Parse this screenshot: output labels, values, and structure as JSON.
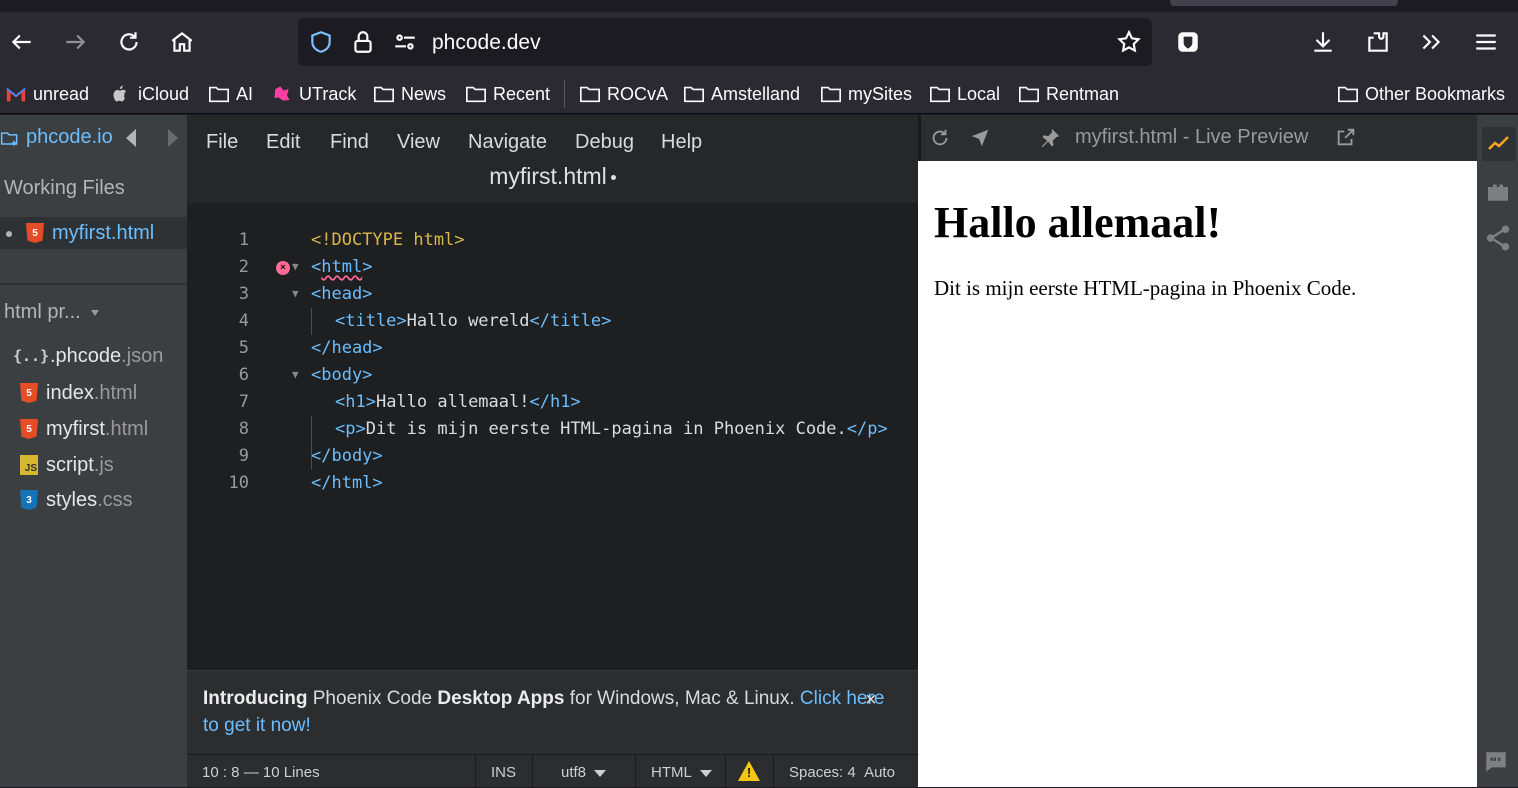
{
  "browser": {
    "url": "phcode.dev",
    "icons": [
      "back-icon",
      "forward-icon",
      "reload-icon",
      "home-icon",
      "shield-icon",
      "lock-icon",
      "permissions-icon",
      "bookmark-star-icon",
      "bitwarden-icon",
      "download-icon",
      "extensions-icon",
      "overflow-icon",
      "menu-icon"
    ],
    "bookmarks": [
      {
        "label": "unread",
        "icon": "gmail-icon"
      },
      {
        "label": "iCloud",
        "icon": "apple-icon"
      },
      {
        "label": "AI",
        "icon": "folder-icon"
      },
      {
        "label": "UTrack",
        "icon": "utrack-icon"
      },
      {
        "label": "News",
        "icon": "folder-icon"
      },
      {
        "label": "Recent",
        "icon": "folder-icon"
      },
      {
        "label": "ROCvA",
        "icon": "folder-icon"
      },
      {
        "label": "Amstelland",
        "icon": "folder-icon"
      },
      {
        "label": "mySites",
        "icon": "folder-icon"
      },
      {
        "label": "Local",
        "icon": "folder-icon"
      },
      {
        "label": "Rentman",
        "icon": "folder-icon"
      },
      {
        "label": "Other Bookmarks",
        "icon": "folder-icon"
      }
    ]
  },
  "sidebar": {
    "project": "phcode.io",
    "working_files_heading": "Working Files",
    "working_files": [
      {
        "name": "myfirst",
        "ext": ".html",
        "badge": "5"
      }
    ],
    "project_tree_heading": "html pr...",
    "files": [
      {
        "name": ".phcode",
        "ext": ".json",
        "badge": "{..}"
      },
      {
        "name": "index",
        "ext": ".html",
        "badge": "5"
      },
      {
        "name": "myfirst",
        "ext": ".html",
        "badge": "5"
      },
      {
        "name": "script",
        "ext": ".js",
        "badge": "JS"
      },
      {
        "name": "styles",
        "ext": ".css",
        "badge": "3"
      }
    ]
  },
  "editor": {
    "menu": [
      "File",
      "Edit",
      "Find",
      "View",
      "Navigate",
      "Debug",
      "Help"
    ],
    "document_title": "myfirst.html",
    "lines": [
      "1",
      "2",
      "3",
      "4",
      "5",
      "6",
      "7",
      "8",
      "9",
      "10"
    ]
  },
  "banner": {
    "intro": "Introducing",
    "part1": " Phoenix Code ",
    "bold2": "Desktop Apps",
    "part2": " for Windows, Mac & Linux. ",
    "link": "Click here to get it now!",
    "close": "×"
  },
  "status": {
    "position": "10 : 8 — 10 Lines",
    "mode": "INS",
    "encoding": "utf8",
    "language": "HTML",
    "warning_icon": "!",
    "spaces_label": "Spaces:",
    "spaces_value": "4",
    "spaces_auto": "Auto"
  },
  "preview": {
    "title": "myfirst.html - Live Preview",
    "heading": "Hallo allemaal!",
    "paragraph": "Dit is mijn eerste HTML-pagina in Phoenix Code."
  },
  "rightbar": {
    "icons": [
      "live-preview-icon",
      "extensions-icon",
      "share-icon",
      "feedback-icon"
    ]
  },
  "colors": {
    "accent": "#6bbeff",
    "doctype": "#d9b84a",
    "error": "#ff6b94",
    "warning": "#f6c611"
  }
}
